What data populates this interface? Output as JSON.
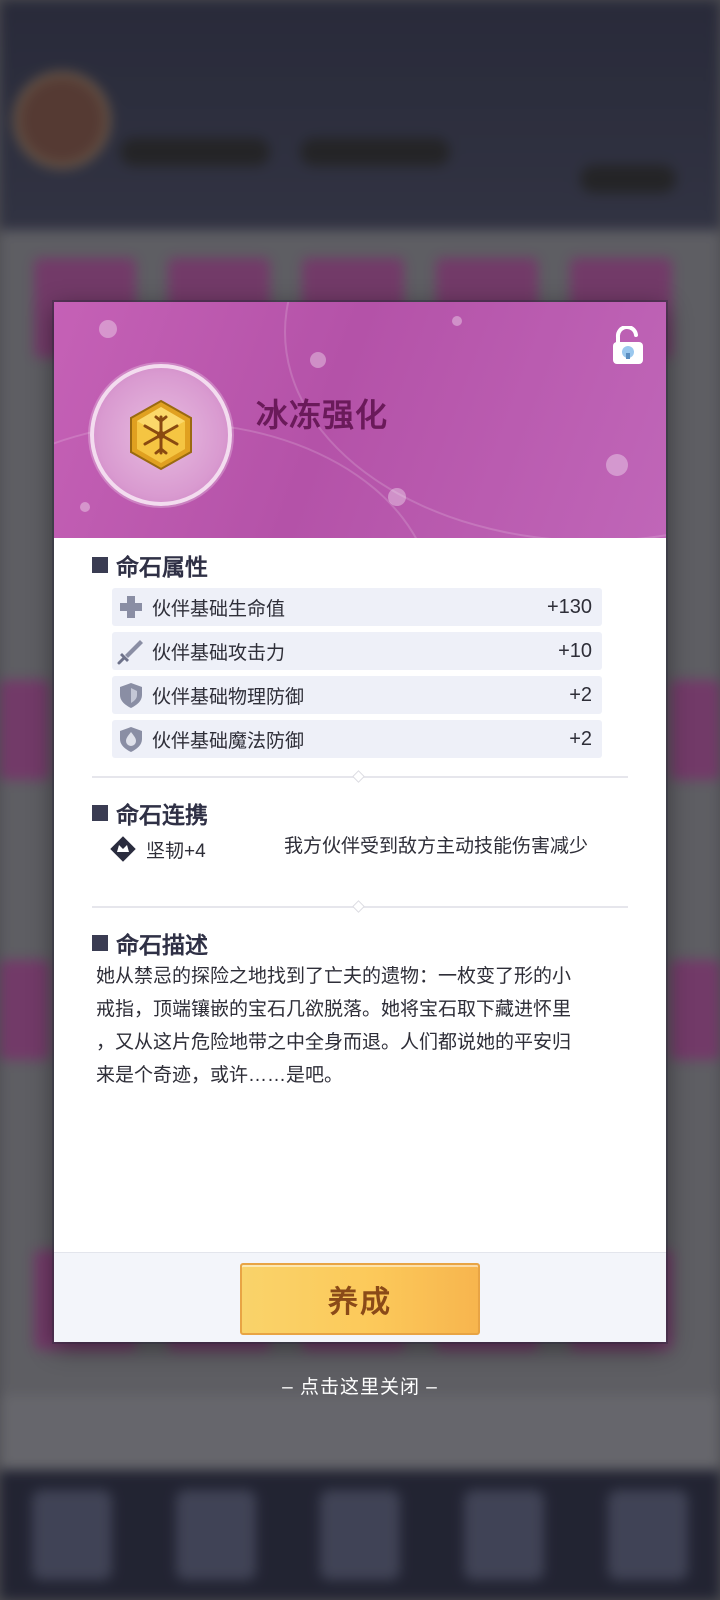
{
  "title": "冰冻强化",
  "sections": {
    "attributes": "命石属性",
    "link": "命石连携",
    "description": "命石描述"
  },
  "attributes": [
    {
      "icon": "health-cross-icon",
      "label": "伙伴基础生命值",
      "value": "+130"
    },
    {
      "icon": "sword-icon",
      "label": "伙伴基础攻击力",
      "value": "+10"
    },
    {
      "icon": "physical-shield-icon",
      "label": "伙伴基础物理防御",
      "value": "+2"
    },
    {
      "icon": "magic-shield-icon",
      "label": "伙伴基础魔法防御",
      "value": "+2"
    }
  ],
  "link": {
    "icon": "crown-badge-icon",
    "name": "坚韧+4",
    "description": "我方伙伴受到敌方主动技能伤害减少"
  },
  "description_lines": [
    "她从禁忌的探险之地找到了亡夫的遗物：一枚变了形的小",
    "戒指，顶端镶嵌的宝石几欲脱落。她将宝石取下藏进怀里",
    "，又从这片危险地带之中全身而退。人们都说她的平安归",
    "来是个奇迹，或许……是吧。"
  ],
  "button_label": "养成",
  "close_hint": "– 点击这里关闭 –",
  "colors": {
    "header": "#c561b6",
    "title": "#6a1a5a",
    "button": "#fcc95a"
  }
}
